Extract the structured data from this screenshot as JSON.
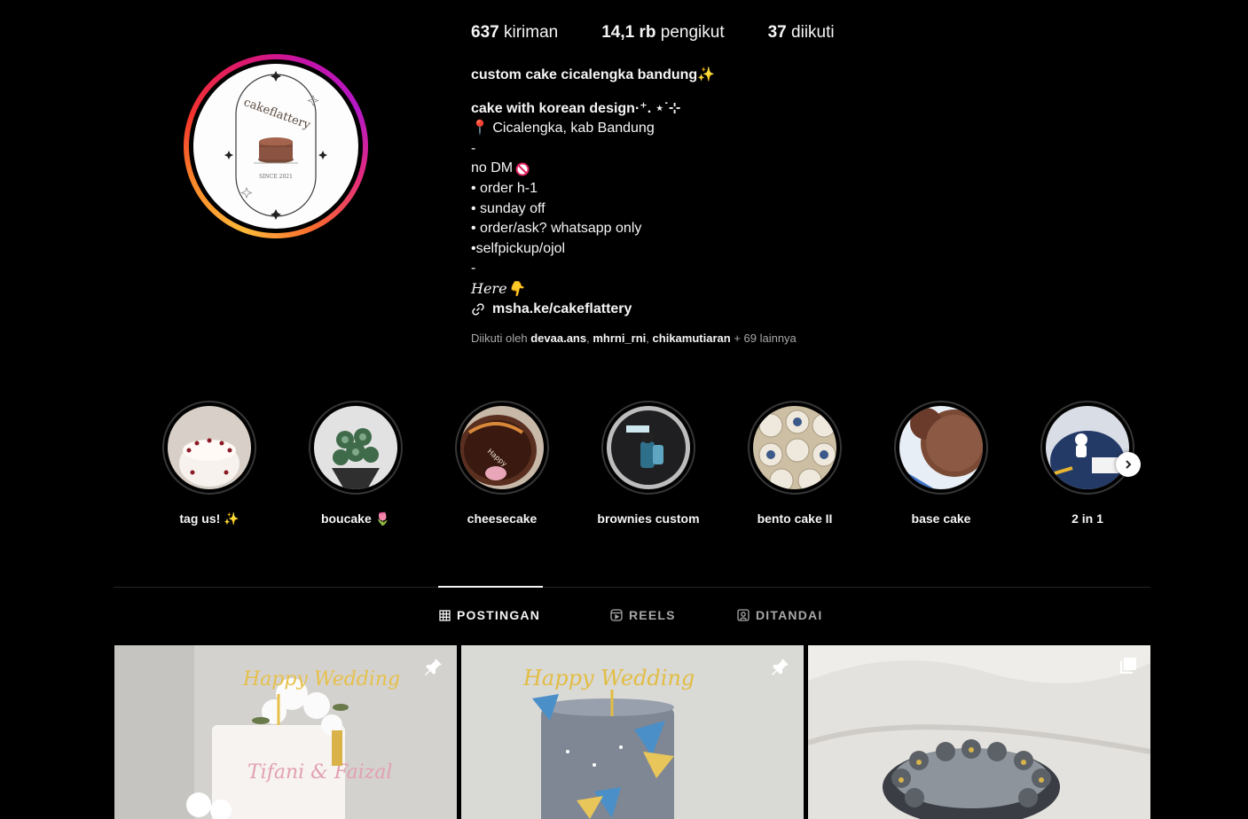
{
  "stats": {
    "posts_count": "637",
    "posts_label": "kiriman",
    "followers_count": "14,1 rb",
    "followers_label": "pengikut",
    "following_count": "37",
    "following_label": "diikuti"
  },
  "bio": {
    "name_line": "custom cake cicalengka bandung✨",
    "tagline": "cake with korean design·⁺. ⋆˙⊹",
    "location": "📍 Cicalengka, kab Bandung",
    "dash1": "-",
    "no_dm": "no DM",
    "rule1": "• order h-1",
    "rule2": "• sunday off",
    "rule3": "• order/ask? whatsapp only",
    "rule4": "•selfpickup/ojol",
    "dash2": "-",
    "here": "𝐻𝑒𝑟𝑒👇",
    "link": "msha.ke/cakeflattery"
  },
  "followed_by": {
    "prefix": "Diikuti oleh",
    "user1": "devaa.ans",
    "user2": "mhrni_rni",
    "user3": "chikamutiaran",
    "more": "+ 69 lainnya"
  },
  "logo": {
    "brand": "cakeflattery",
    "since": "SINCE 2021"
  },
  "highlights": [
    {
      "label": "tag us! ✨"
    },
    {
      "label": "boucake 🌷"
    },
    {
      "label": "cheesecake"
    },
    {
      "label": "brownies custom"
    },
    {
      "label": "bento cake II"
    },
    {
      "label": "base cake"
    },
    {
      "label": "2 in 1"
    }
  ],
  "tabs": {
    "posts": "POSTINGAN",
    "reels": "REELS",
    "tagged": "DITANDAI"
  },
  "posts": [
    {
      "topper": "Happy Wedding",
      "names": "Tifani & Faizal",
      "badge": "pin-icon"
    },
    {
      "topper": "Happy Wedding",
      "badge": "pin-icon"
    },
    {
      "badge": "carousel-icon"
    }
  ],
  "colors": {
    "accent_ring_start": "#fdb93a",
    "accent_ring_mid": "#e01a68",
    "accent_ring_end": "#b418c7",
    "text_muted": "#a8a8a8"
  }
}
